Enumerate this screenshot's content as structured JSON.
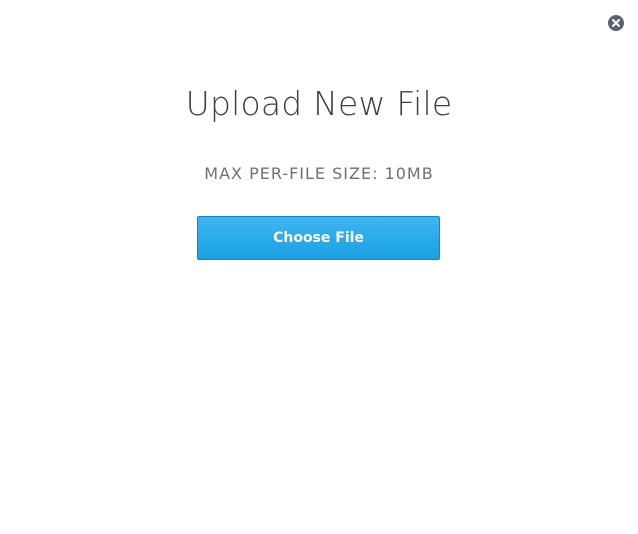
{
  "dialog": {
    "title": "Upload New File",
    "subtitle": "MAX PER-FILE SIZE: 10MB",
    "choose_label": "Choose File",
    "close_icon": "close-icon"
  },
  "colors": {
    "button_top": "#3fb6f0",
    "button_bottom": "#1aa0e4",
    "button_border": "#1386c8",
    "close_bg": "#5a6270",
    "title_text": "#3a3f47",
    "subtitle_text": "#6b7079"
  }
}
